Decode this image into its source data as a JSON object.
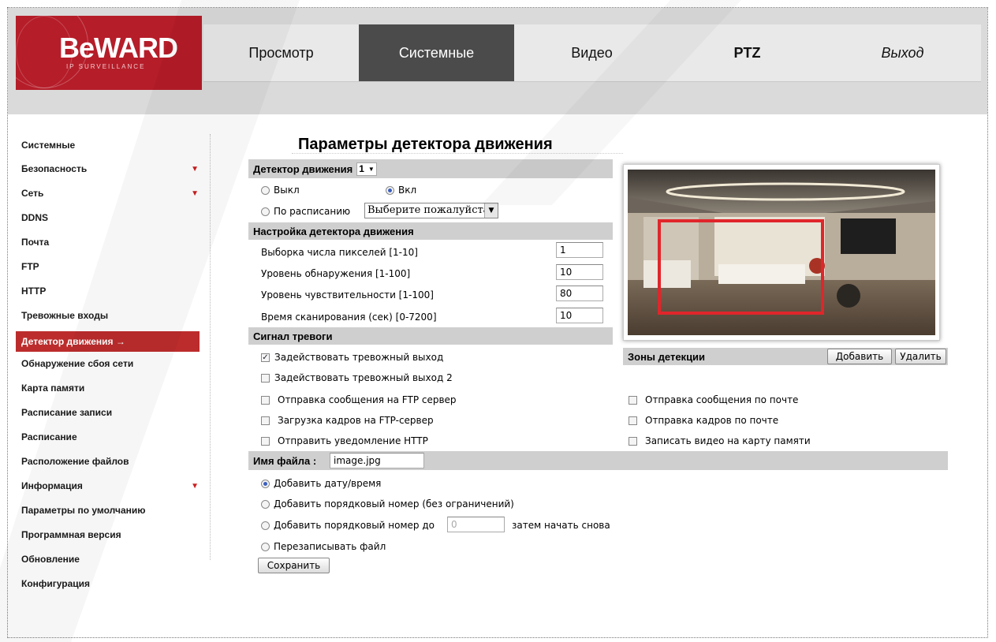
{
  "brand": {
    "logo": "BeWARD",
    "logo_sub": "IP SURVEILLANCE"
  },
  "nav": {
    "tabs": [
      {
        "label": "Просмотр"
      },
      {
        "label": "Системные"
      },
      {
        "label": "Видео"
      },
      {
        "label": "PTZ"
      },
      {
        "label": "Выход"
      }
    ],
    "active_tab": "Системные"
  },
  "sidebar": {
    "items": [
      {
        "label": "Системные"
      },
      {
        "label": "Безопасность",
        "expandable": true
      },
      {
        "label": "Сеть",
        "expandable": true
      },
      {
        "label": "DDNS"
      },
      {
        "label": "Почта"
      },
      {
        "label": "FTP"
      },
      {
        "label": "HTTP"
      },
      {
        "label": "Тревожные входы"
      },
      {
        "label": "Детектор движения",
        "active_arrow": "→"
      },
      {
        "label": "Обнаружение сбоя сети"
      },
      {
        "label": "Карта памяти"
      },
      {
        "label": "Расписание записи"
      },
      {
        "label": "Расписание"
      },
      {
        "label": "Расположение файлов"
      },
      {
        "label": "Информация",
        "expandable": true
      },
      {
        "label": "Параметры по умолчанию"
      },
      {
        "label": "Программная версия"
      },
      {
        "label": "Обновление"
      },
      {
        "label": "Конфигурация"
      }
    ]
  },
  "page": {
    "title": "Параметры детектора движения",
    "detector": {
      "label": "Детектор движения",
      "selected": "1",
      "off_label": "Выкл",
      "on_label": "Вкл",
      "schedule_label": "По расписанию",
      "schedule_select": "Выберите пожалуйста",
      "mode": "on"
    },
    "settings": {
      "header": "Настройка детектора движения",
      "fields": [
        {
          "label": "Выборка числа пикселей [1-10]",
          "value": "1"
        },
        {
          "label": "Уровень обнаружения [1-100]",
          "value": "10"
        },
        {
          "label": "Уровень чувствительности [1-100]",
          "value": "80"
        },
        {
          "label": "Время сканирования (сек) [0-7200]",
          "value": "10"
        }
      ]
    },
    "alarm": {
      "header": "Сигнал тревоги",
      "output1": {
        "label": "Задействовать тревожный выход",
        "checked": true
      },
      "output2": {
        "label": "Задействовать тревожный выход 2",
        "checked": false
      },
      "left_options": [
        {
          "label": "Отправка сообщения на FTP сервер",
          "checked": false
        },
        {
          "label": "Загрузка кадров на FTP-сервер",
          "checked": false
        },
        {
          "label": "Отправить уведомление HTTP",
          "checked": false
        }
      ],
      "right_options": [
        {
          "label": "Отправка сообщения по почте",
          "checked": false
        },
        {
          "label": "Отправка кадров по почте",
          "checked": false
        },
        {
          "label": "Записать видео на карту памяти",
          "checked": false
        }
      ]
    },
    "zones": {
      "label": "Зоны детекции",
      "add_label": "Добавить",
      "delete_label": "Удалить"
    },
    "filename": {
      "label": "Имя файла :",
      "value": "image.jpg",
      "options": {
        "add_datetime": "Добавить дату/время",
        "add_seq_unlimited": "Добавить порядковый номер (без ограничений)",
        "add_seq_until": "Добавить порядковый номер до",
        "seq_placeholder": "0",
        "then_restart": "затем начать снова",
        "overwrite": "Перезаписывать файл"
      },
      "selected": "add_datetime"
    },
    "save_label": "Сохранить"
  },
  "colors": {
    "brand_red": "#b51d29",
    "active_tab": "#4b4b4b",
    "active_sidebar": "#bc2c2c",
    "section_bar": "#cfcfcf",
    "detection_zone": "#e0262b"
  }
}
